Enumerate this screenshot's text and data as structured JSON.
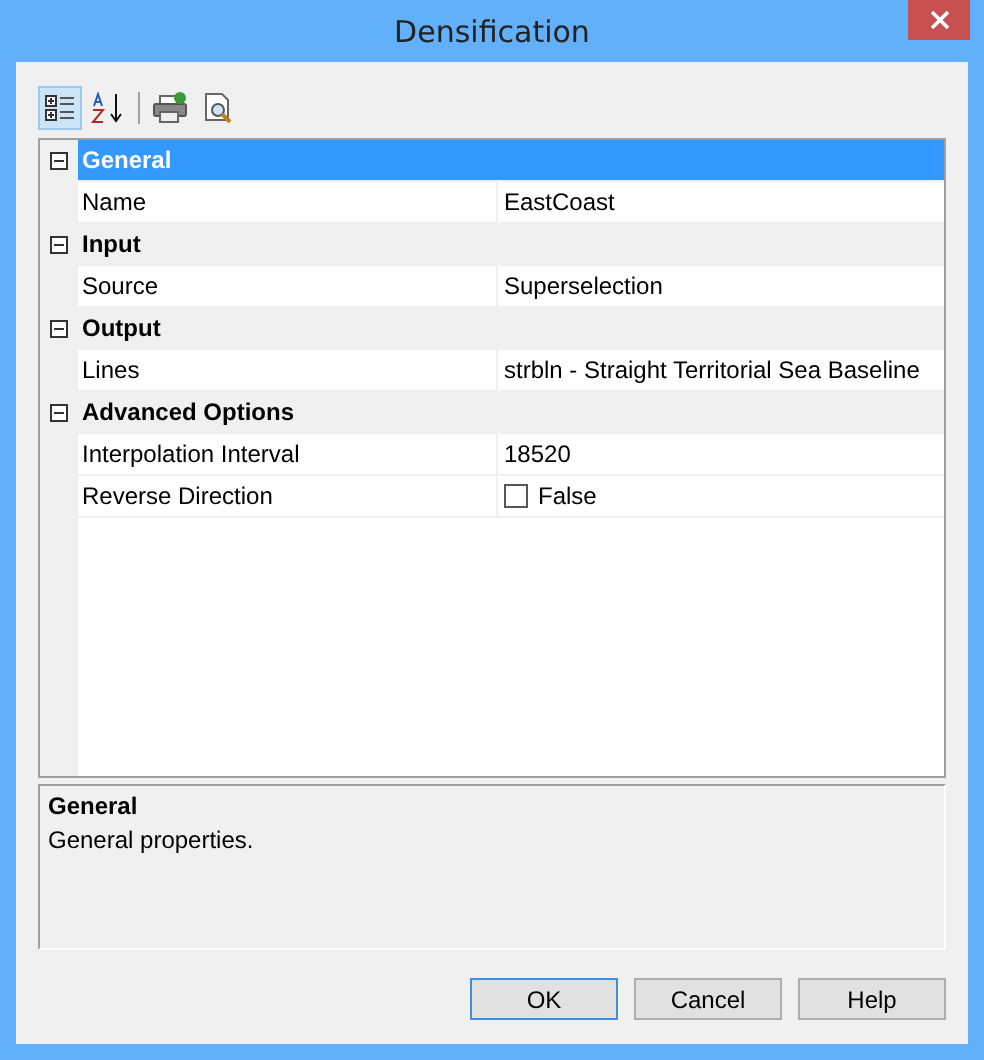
{
  "window": {
    "title": "Densification"
  },
  "toolbar": [
    {
      "kind": "categorized",
      "selected": true
    },
    {
      "kind": "alphabetical",
      "selected": false
    },
    {
      "kind": "separator"
    },
    {
      "kind": "print",
      "selected": false
    },
    {
      "kind": "preview",
      "selected": false
    }
  ],
  "categories": [
    {
      "name": "General",
      "expanded": true,
      "selected": true,
      "properties": [
        {
          "kind": "text",
          "name": "Name",
          "value": "EastCoast"
        }
      ]
    },
    {
      "name": "Input",
      "expanded": true,
      "selected": false,
      "properties": [
        {
          "kind": "text",
          "name": "Source",
          "value": "Superselection"
        }
      ]
    },
    {
      "name": "Output",
      "expanded": true,
      "selected": false,
      "properties": [
        {
          "kind": "text",
          "name": "Lines",
          "value": "strbln - Straight Territorial Sea Baseline"
        }
      ]
    },
    {
      "name": "Advanced Options",
      "expanded": true,
      "selected": false,
      "properties": [
        {
          "kind": "text",
          "name": "Interpolation Interval",
          "value": "18520"
        },
        {
          "kind": "checkbox",
          "name": "Reverse Direction",
          "value": "False",
          "checked": false
        }
      ]
    }
  ],
  "description": {
    "title": "General",
    "text": "General properties."
  },
  "buttons": [
    {
      "label": "OK",
      "default": true
    },
    {
      "label": "Cancel",
      "default": false
    },
    {
      "label": "Help",
      "default": false
    }
  ]
}
